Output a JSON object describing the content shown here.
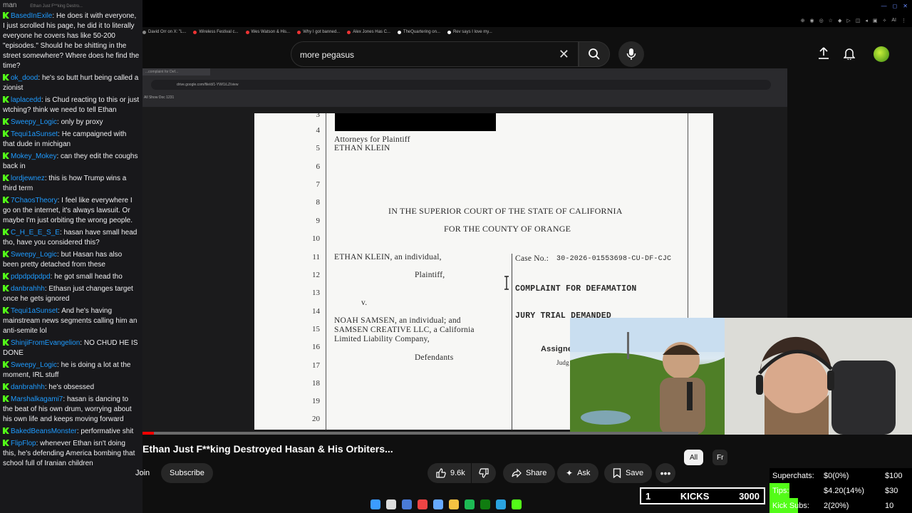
{
  "chat": {
    "top_partial": "man",
    "top_banner": "Ethan Just F**king Destro...",
    "messages": [
      {
        "user": "BasedInExile",
        "text": "He does it with everyone, I just scrolled his page, he did it to literally everyone he covers has like 50-200 \"episodes.\" Should he be shitting in the street somewhere? Where does he find the time?"
      },
      {
        "user": "ok_dood",
        "text": "he's so butt hurt being called a zionist"
      },
      {
        "user": "laplacedd",
        "text": "is Chud reacting to this or just wtching? think we need to tell Ethan"
      },
      {
        "user": "Sweepy_Logic",
        "text": "only by proxy"
      },
      {
        "user": "Tequi1aSunset",
        "text": "He campaigned with that dude in michigan"
      },
      {
        "user": "Mokey_Mokey",
        "text": "can they edit the coughs back in"
      },
      {
        "user": "lordjewnez",
        "text": "this is how Trump wins a third term"
      },
      {
        "user": "7ChaosTheory",
        "text": "I feel like everywhere I go on the internet, it's always lawsuit. Or maybe I'm just orbiting the wrong people."
      },
      {
        "user": "C_H_E_E_S_E",
        "text": "hasan have small head tho, have you considered this?"
      },
      {
        "user": "Sweepy_Logic",
        "text": "but Hasan has also been pretty detached from these"
      },
      {
        "user": "pdpdpdpdpd",
        "text": "he got small head tho"
      },
      {
        "user": "danbrahhh",
        "text": "Ethasn just changes target once he gets ignored"
      },
      {
        "user": "Tequi1aSunset",
        "text": "And he's having mainstream news segments calling him an anti-semite lol"
      },
      {
        "user": "ShinjiFromEvangelion",
        "text": "NO CHUD HE IS DONE"
      },
      {
        "user": "Sweepy_Logic",
        "text": "he is doing a lot at the moment, IRL stuff"
      },
      {
        "user": "danbrahhh",
        "text": "he's obsessed"
      },
      {
        "user": "Marshalkagami7",
        "text": "hasan is dancing to the beat of his own drum, worrying about his own life and keeps moving forward"
      },
      {
        "user": "BakedBeansMonster",
        "text": "performative shit"
      },
      {
        "user": "FlipFlop",
        "text": "whenever Ethan isn't doing this, he's defending America bombing that school full of Iranian children"
      }
    ]
  },
  "bookmarks": [
    {
      "label": "David Orr on X: \"L...",
      "color": "#888"
    },
    {
      "label": "Wireless Festival c...",
      "color": "#e33"
    },
    {
      "label": "Wes Watson & His...",
      "color": "#e33"
    },
    {
      "label": "Why I got banned...",
      "color": "#e33"
    },
    {
      "label": "Alex Jones Has C...",
      "color": "#e33"
    },
    {
      "label": "TheQuartering on...",
      "color": "#fff"
    },
    {
      "label": "Rev says I love my...",
      "color": "#fff"
    }
  ],
  "search": {
    "query": "more pegasus"
  },
  "inner_browser": {
    "tab": "...complaint for Def...",
    "url": "drive.google.com/file/d/1-YW/1iLZ/view",
    "bookmark": "All Show Doc 1231"
  },
  "document": {
    "line_numbers": [
      "3",
      "4",
      "5",
      "6",
      "7",
      "8",
      "9",
      "10",
      "11",
      "12",
      "13",
      "14",
      "15",
      "16",
      "17",
      "18",
      "19",
      "20"
    ],
    "attorneys_line1": "Attorneys for Plaintiff",
    "attorneys_line2": "ETHAN KLEIN",
    "court_line1": "IN THE SUPERIOR COURT OF THE STATE OF CALIFORNIA",
    "court_line2": "FOR THE COUNTY OF ORANGE",
    "plaintiff_name": "ETHAN KLEIN, an individual,",
    "plaintiff_label": "Plaintiff,",
    "versus": "v.",
    "defendant1": "NOAH SAMSEN, an individual; and",
    "defendant2": "SAMSEN CREATIVE LLC, a California",
    "defendant3": "Limited Liability Company,",
    "defendants_label": "Defendants",
    "case_no_label": "Case No.:",
    "case_no": "30-2026-01553698-CU-DF-CJC",
    "complaint_title": "COMPLAINT FOR DEFAMATION",
    "jury_demand": "JURY TRIAL DEMANDED",
    "assigned": "Assigne",
    "judge": "Judg"
  },
  "video": {
    "title": "Ethan Just F**king Destroyed Hasan & His Orbiters...",
    "progress": 0.02,
    "join_label": "Join",
    "subscribe_label": "Subscribe",
    "likes": "9.6k",
    "share_label": "Share",
    "ask_label": "Ask",
    "save_label": "Save",
    "chips": [
      "All",
      "Fr"
    ]
  },
  "stream": {
    "kicks_count": "1",
    "kicks_label": "KICKS",
    "kicks_goal": "3000",
    "superchats_label": "Superchats:",
    "superchats_value": "$0(0%)",
    "superchats_goal": "$100",
    "tips_label": "Tips:",
    "tips_value": "$4.20(14%)",
    "tips_goal": "$30",
    "tips_fraction": 0.14,
    "subs_label": "Kick Subs:",
    "subs_value": "2(20%)",
    "subs_goal": "10",
    "subs_fraction": 0.2
  },
  "taskbar": [
    "windows-icon",
    "search-icon",
    "app-icon",
    "app-icon",
    "chrome-icon",
    "folder-icon",
    "spotify-icon",
    "xbox-icon",
    "telegram-icon",
    "app-icon"
  ],
  "colors": {
    "kick_green": "#53fc18",
    "chat_user": "#1e9bff",
    "yt_red": "#ff0000"
  }
}
